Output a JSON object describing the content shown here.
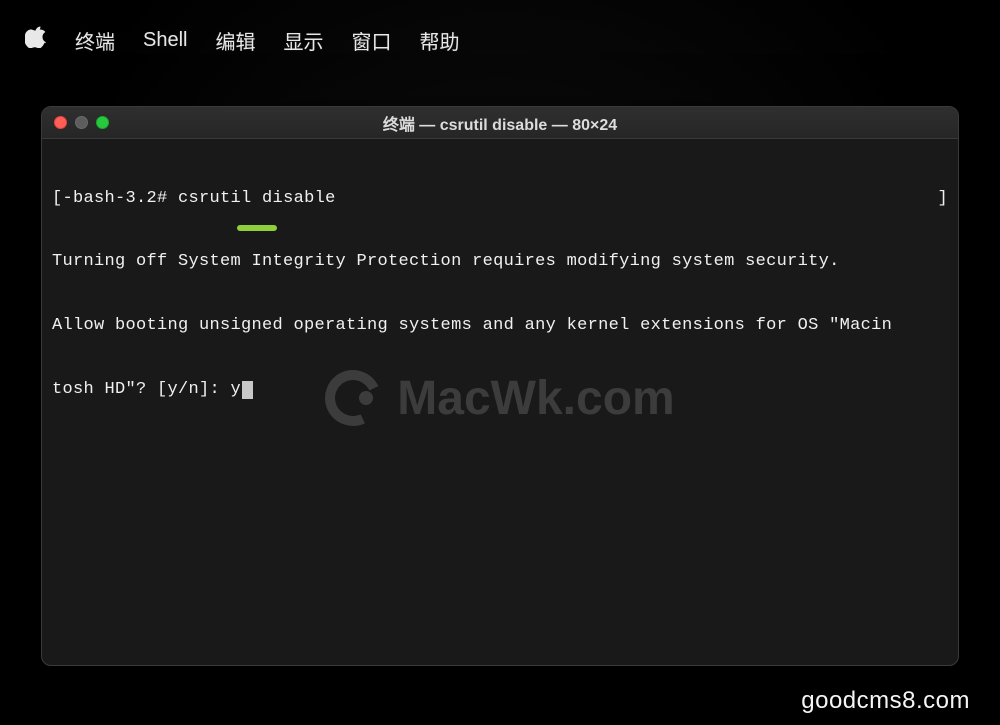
{
  "menubar": {
    "items": [
      "终端",
      "Shell",
      "编辑",
      "显示",
      "窗口",
      "帮助"
    ]
  },
  "window": {
    "title": "终端 — csrutil disable — 80×24"
  },
  "terminal": {
    "prompt": "-bash-3.2# ",
    "command": "csrutil disable",
    "line2": "Turning off System Integrity Protection requires modifying system security.",
    "line3": "Allow booting unsigned operating systems and any kernel extensions for OS \"Macin",
    "line4_prefix": "tosh HD\"? [y/n]: ",
    "user_input": "y",
    "right_marker": "]"
  },
  "watermark": {
    "text": "MacWk.com"
  },
  "footer": {
    "text": "goodcms8.com"
  }
}
